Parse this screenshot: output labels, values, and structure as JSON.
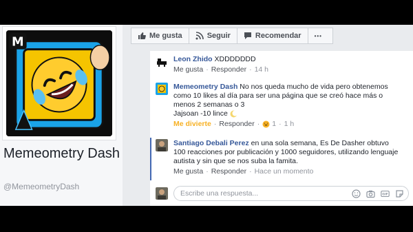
{
  "page": {
    "name": "Memeometry Dash",
    "handle": "@MemeometryDash"
  },
  "actions": {
    "like": "Me gusta",
    "follow": "Seguir",
    "recommend": "Recomendar",
    "more": "•••"
  },
  "comments": [
    {
      "author": "Leon Zhido",
      "text": "XDDDDDDD",
      "like": "Me gusta",
      "reply": "Responder",
      "time": "14 h"
    },
    {
      "author": "Memeometry Dash",
      "text": "No nos queda mucho de vida pero obtenemos como 10 likes al día para ser una página que se creó hace más o menos 2 semanas o 3",
      "text2": "Jajsoan -10 lince",
      "reaction": "Me divierte",
      "reply": "Responder",
      "reaction_count": "1",
      "time": "1 h"
    },
    {
      "author": "Santiago Debali Perez",
      "text": "en una sola semana, Es De Dasher obtuvo 100 reacciones por publicación y 1000 seguidores, utilizando lenguaje autista y sin que se nos suba la famita.",
      "like": "Me gusta",
      "reply": "Responder",
      "time": "Hace un momento"
    }
  ],
  "reply_box": {
    "placeholder": "Escribe una respuesta..."
  },
  "colors": {
    "link_blue": "#365899",
    "accent": "#4267b2",
    "haha": "#f7b125"
  }
}
